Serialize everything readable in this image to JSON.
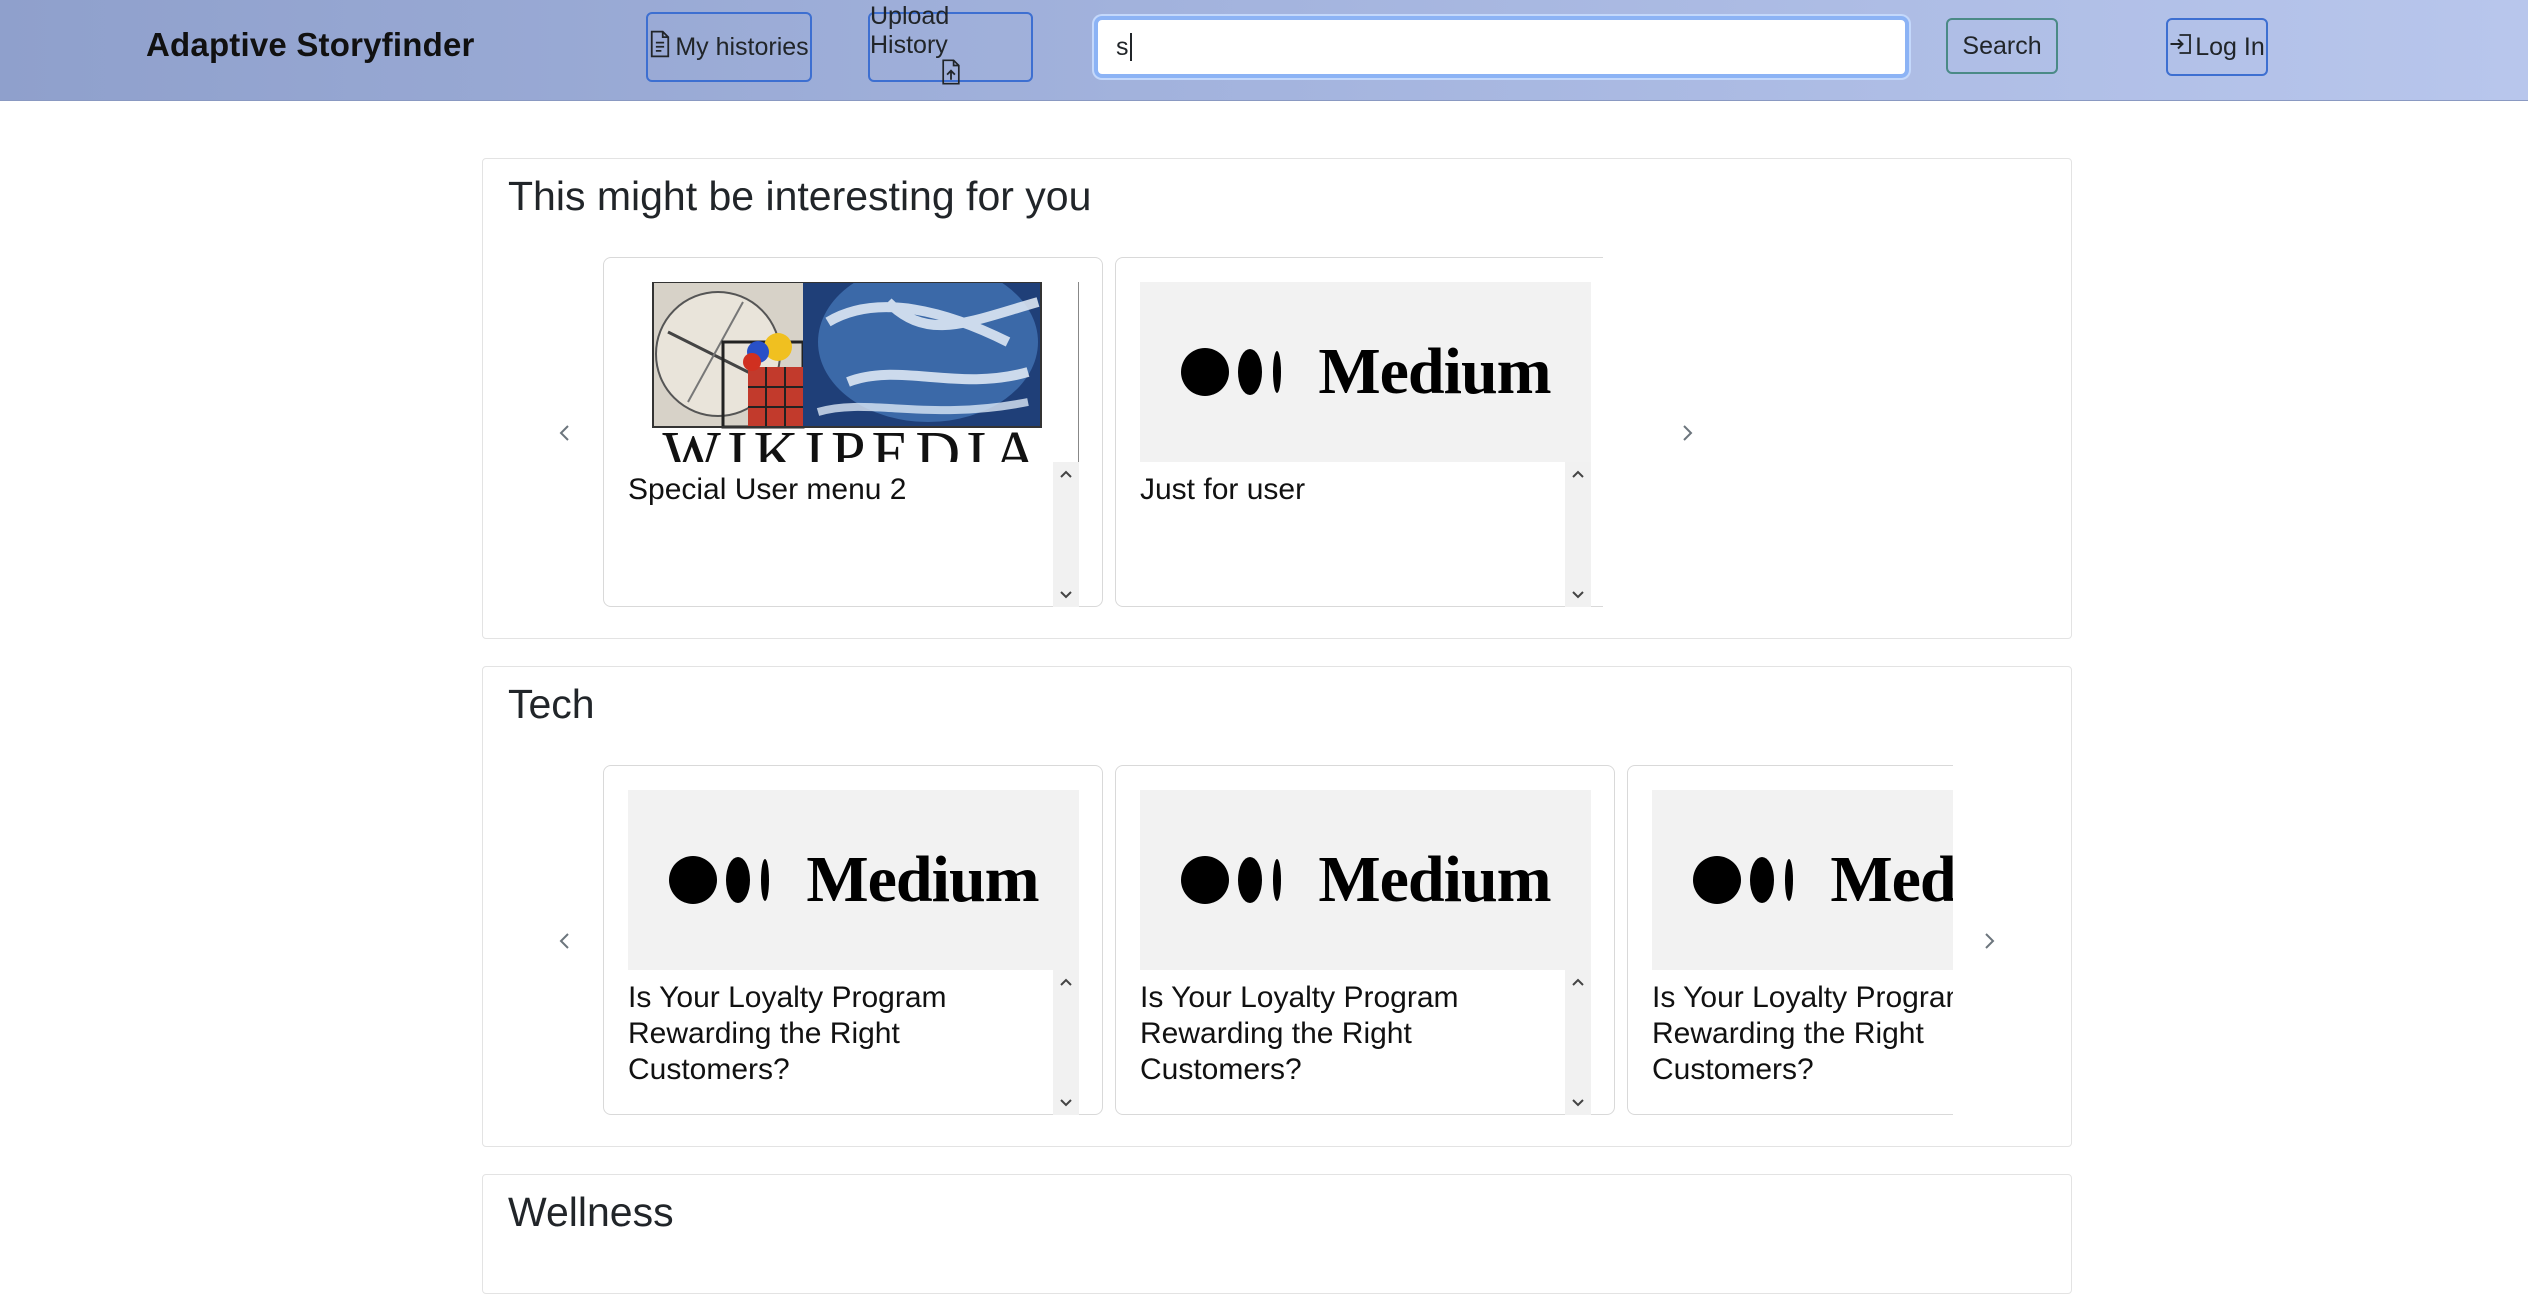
{
  "app": {
    "brand": "Adaptive Storyfinder"
  },
  "nav": {
    "histories_label": "My histories",
    "upload_label": "Upload History",
    "search_value": "s",
    "search_button": "Search",
    "login_label": "Log In"
  },
  "sections": [
    {
      "title": "This might be interesting for you",
      "cards": [
        {
          "title": "Special User menu 2",
          "image": "wikipedia-logo-image",
          "image_text": "WIKIPEDIA"
        },
        {
          "title": "Just for user",
          "image": "medium-logo-image",
          "image_text": "Medium"
        }
      ]
    },
    {
      "title": "Tech",
      "cards": [
        {
          "title": "Is Your Loyalty Program Rewarding the Right Customers?",
          "image": "medium-logo-image",
          "image_text": "Medium"
        },
        {
          "title": "Is Your Loyalty Program Rewarding the Right Customers?",
          "image": "medium-logo-image",
          "image_text": "Medium"
        },
        {
          "title": "Is Your Loyalty Program Rewarding the Right Customers?",
          "image": "medium-logo-image",
          "image_text": "Medium"
        }
      ]
    },
    {
      "title": "Wellness"
    }
  ],
  "icons": {
    "histories": "file-text-icon",
    "upload": "file-upload-icon",
    "login": "login-icon",
    "prev": "chevron-left-icon",
    "next": "chevron-right-icon"
  }
}
